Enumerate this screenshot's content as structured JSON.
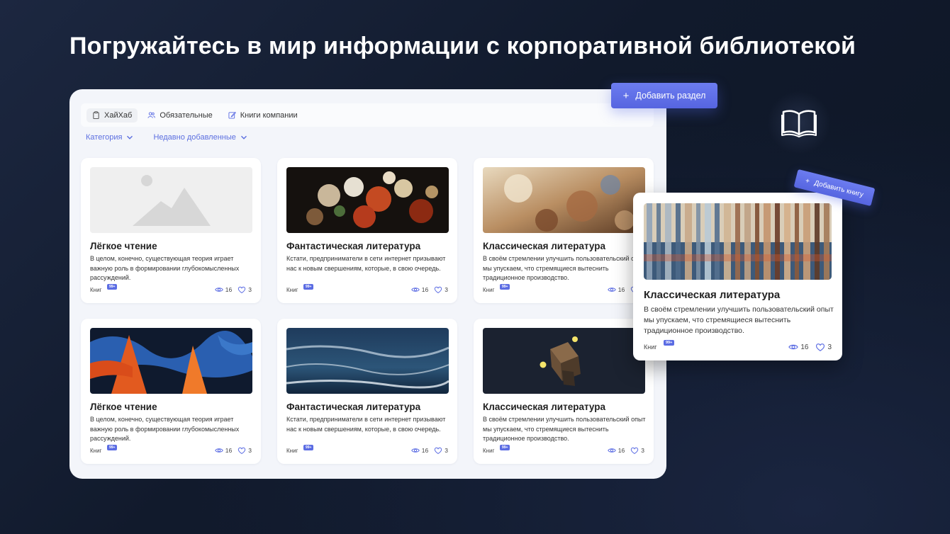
{
  "headline": "Погружайтесь в мир информации с корпоративной библиотекой",
  "tabs": [
    {
      "label": "ХайХаб",
      "icon": "clipboard-icon",
      "active": true
    },
    {
      "label": "Обязательные",
      "icon": "users-icon",
      "active": false
    },
    {
      "label": "Книги компании",
      "icon": "edit-icon",
      "active": false
    }
  ],
  "filters": [
    {
      "label": "Категория",
      "icon": "chevron-down-icon"
    },
    {
      "label": "Недавно добавленные",
      "icon": "chevron-down-icon"
    }
  ],
  "add_section_button": {
    "label": "Добавить раздел",
    "icon": "plus-icon"
  },
  "add_book_button": {
    "label": "Добавить книгу",
    "icon": "plus-icon"
  },
  "cards": [
    {
      "title": "Лёгкое чтение",
      "desc": "В целом, конечно, существующая теория играет важную роль в формировании глубокомысленных рассуждений.",
      "kind": "Книг",
      "badge": "99+",
      "views": "16",
      "likes": "3",
      "image": "placeholder-image"
    },
    {
      "title": "Фантастическая литература",
      "desc": "Кстати, предприниматели в сети интернет призывают нас к новым свершениям, которые, в свою очередь.",
      "kind": "Книг",
      "badge": "99+",
      "views": "16",
      "likes": "3",
      "image": "flowers-painting"
    },
    {
      "title": "Классическая литература",
      "desc": "В своём стремлении улучшить пользовательский опыт мы упускаем, что стремящиеся вытеснить традиционное производство.",
      "kind": "Книг",
      "badge": "99+",
      "views": "16",
      "likes": "3",
      "image": "baroque-painting"
    },
    {
      "title": "Лёгкое чтение",
      "desc": "В целом, конечно, существующая теория играет важную роль в формировании глубокомысленных рассуждений.",
      "kind": "Книг",
      "badge": "99+",
      "views": "16",
      "likes": "3",
      "image": "abstract-paint"
    },
    {
      "title": "Фантастическая литература",
      "desc": "Кстати, предприниматели в сети интернет призывают нас к новым свершениям, которые, в свою очередь.",
      "kind": "Книг",
      "badge": "99+",
      "views": "16",
      "likes": "3",
      "image": "sea-painting"
    },
    {
      "title": "Классическая литература",
      "desc": "В своём стремлении улучшить пользовательский опыт мы упускаем, что стремящиеся вытеснить традиционное производство.",
      "kind": "Книг",
      "badge": "99+",
      "views": "16",
      "likes": "3",
      "image": "cubes-render"
    }
  ],
  "featured_card": {
    "title": "Классическая литература",
    "desc": "В своём стремлении улучшить пользовательский опыт мы упускаем, что стремящиеся вытеснить традиционное производство.",
    "kind": "Книг",
    "badge": "99+",
    "views": "16",
    "likes": "3",
    "image": "glass-stripes"
  },
  "colors": {
    "accent": "#5b6ce3",
    "background": "#131c2e",
    "panel": "#f3f5fa"
  }
}
